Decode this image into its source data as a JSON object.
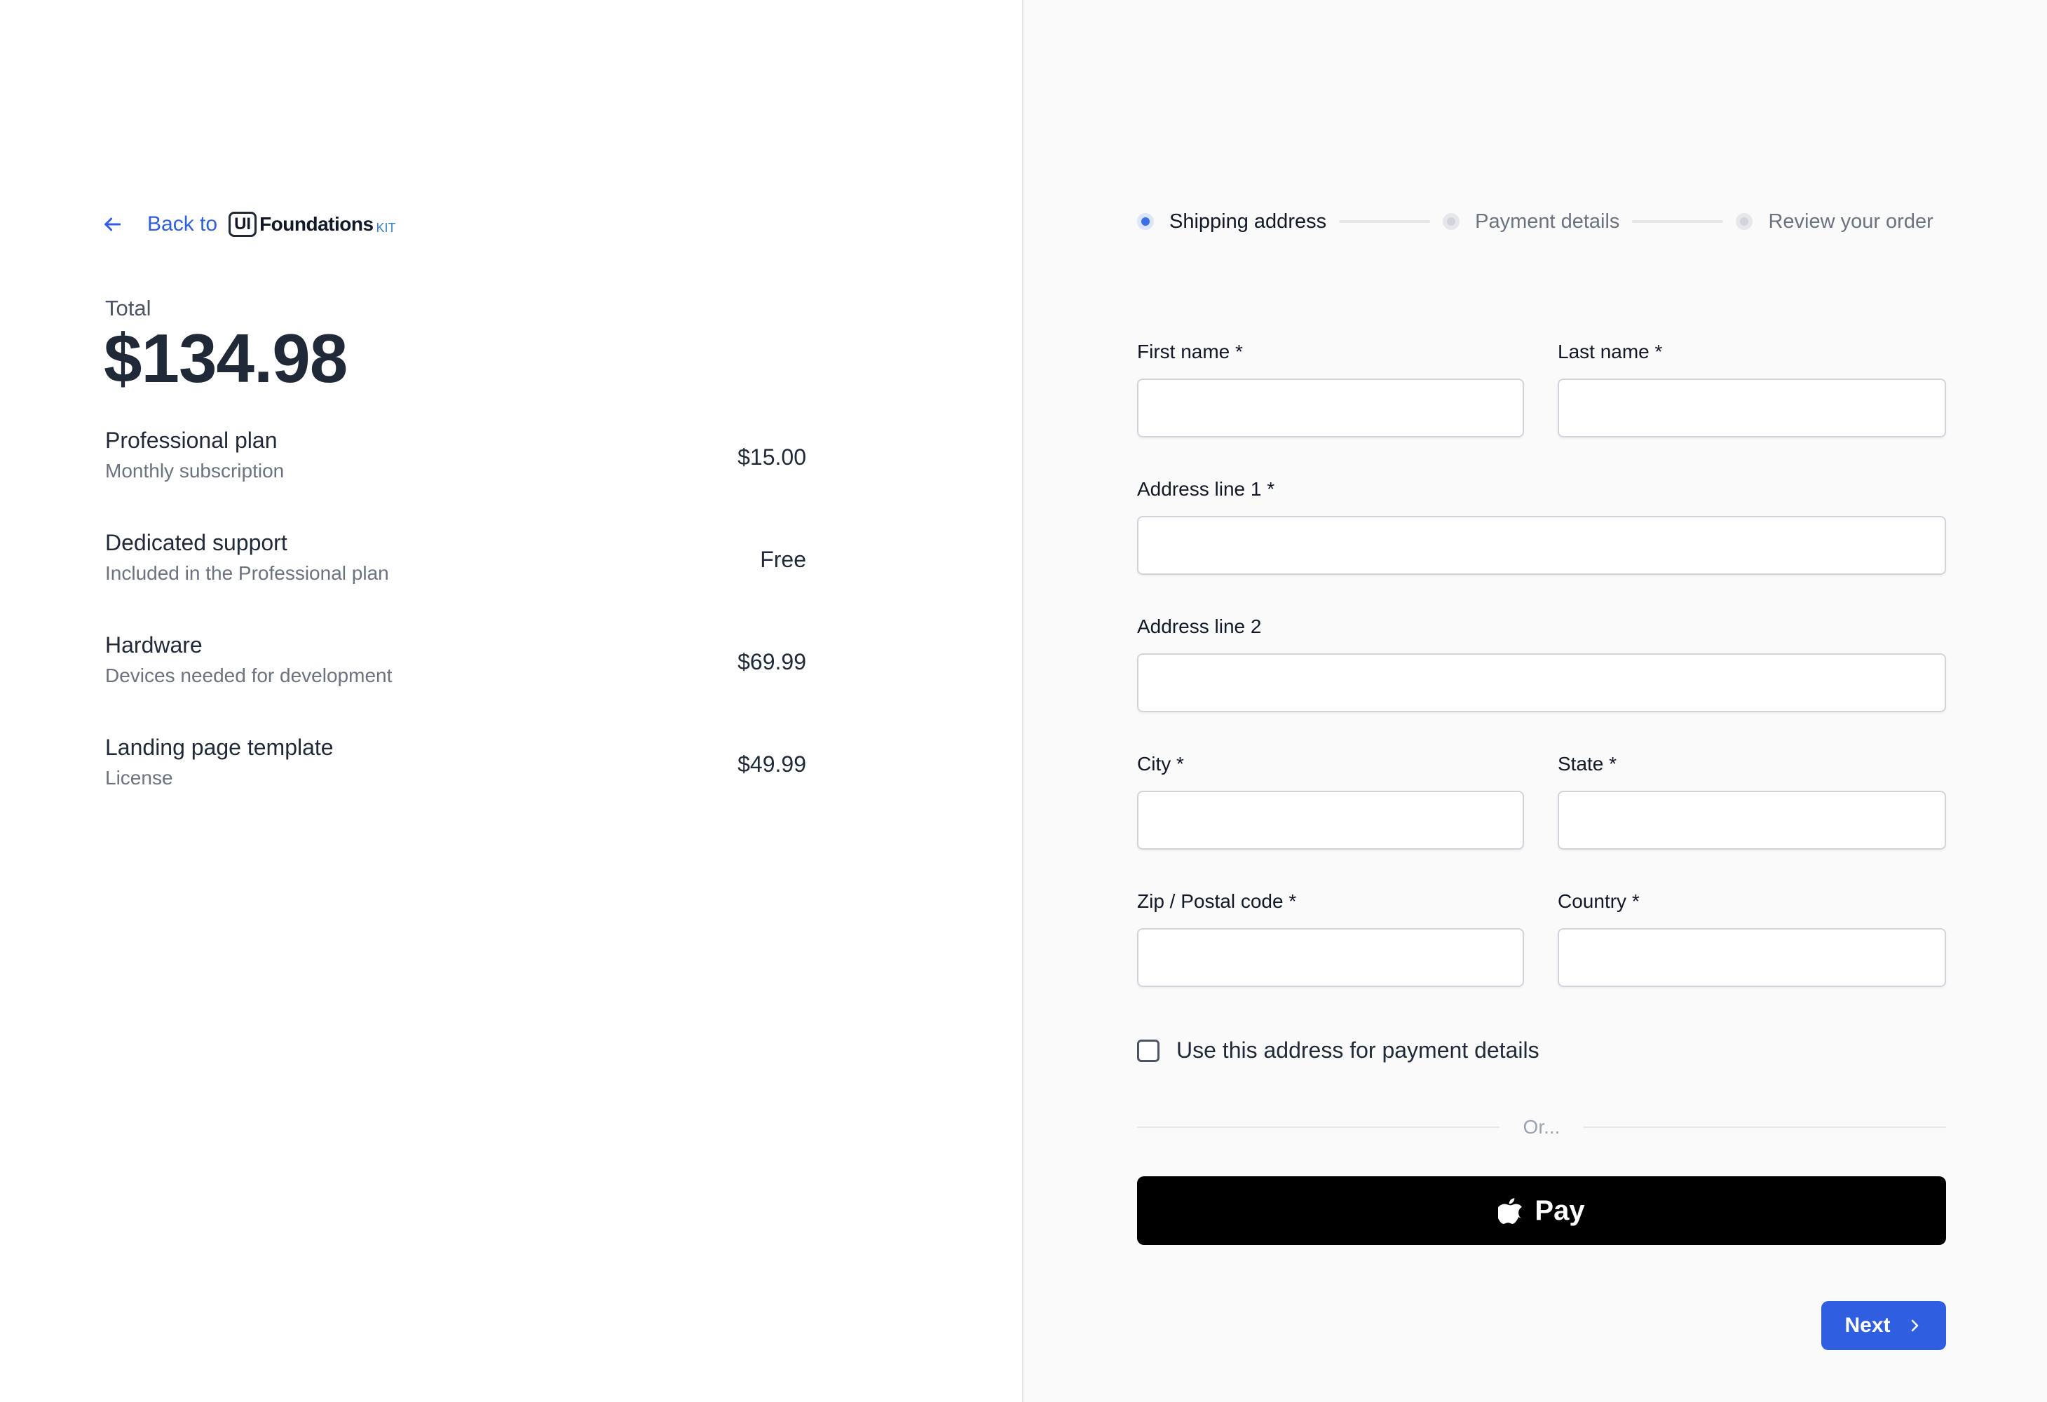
{
  "back": {
    "label": "Back to",
    "brand_box": "UI",
    "brand_name": "Foundations",
    "brand_suffix": "KIT"
  },
  "summary": {
    "total_label": "Total",
    "total_value": "$134.98",
    "items": [
      {
        "name": "Professional plan",
        "desc": "Monthly subscription",
        "price": "$15.00"
      },
      {
        "name": "Dedicated support",
        "desc": "Included in the Professional plan",
        "price": "Free"
      },
      {
        "name": "Hardware",
        "desc": "Devices needed for development",
        "price": "$69.99"
      },
      {
        "name": "Landing page template",
        "desc": "License",
        "price": "$49.99"
      }
    ]
  },
  "stepper": {
    "steps": [
      {
        "label": "Shipping address",
        "state": "active"
      },
      {
        "label": "Payment details",
        "state": "pending"
      },
      {
        "label": "Review your order",
        "state": "pending"
      }
    ]
  },
  "form": {
    "first_name": "First name *",
    "last_name": "Last name *",
    "address1": "Address line 1 *",
    "address2": "Address line 2",
    "city": "City *",
    "state": "State *",
    "zip": "Zip / Postal code *",
    "country": "Country *",
    "checkbox_label": "Use this address for payment details",
    "checkbox_checked": false,
    "divider": "Or..."
  },
  "applepay": {
    "icon": "apple-icon",
    "label": "Pay"
  },
  "next": {
    "label": "Next",
    "icon": "chevron-right-icon"
  },
  "colors": {
    "accent": "#2f5fe0",
    "text": "#111827",
    "muted": "#6b7280",
    "right_bg": "#fafafa"
  }
}
